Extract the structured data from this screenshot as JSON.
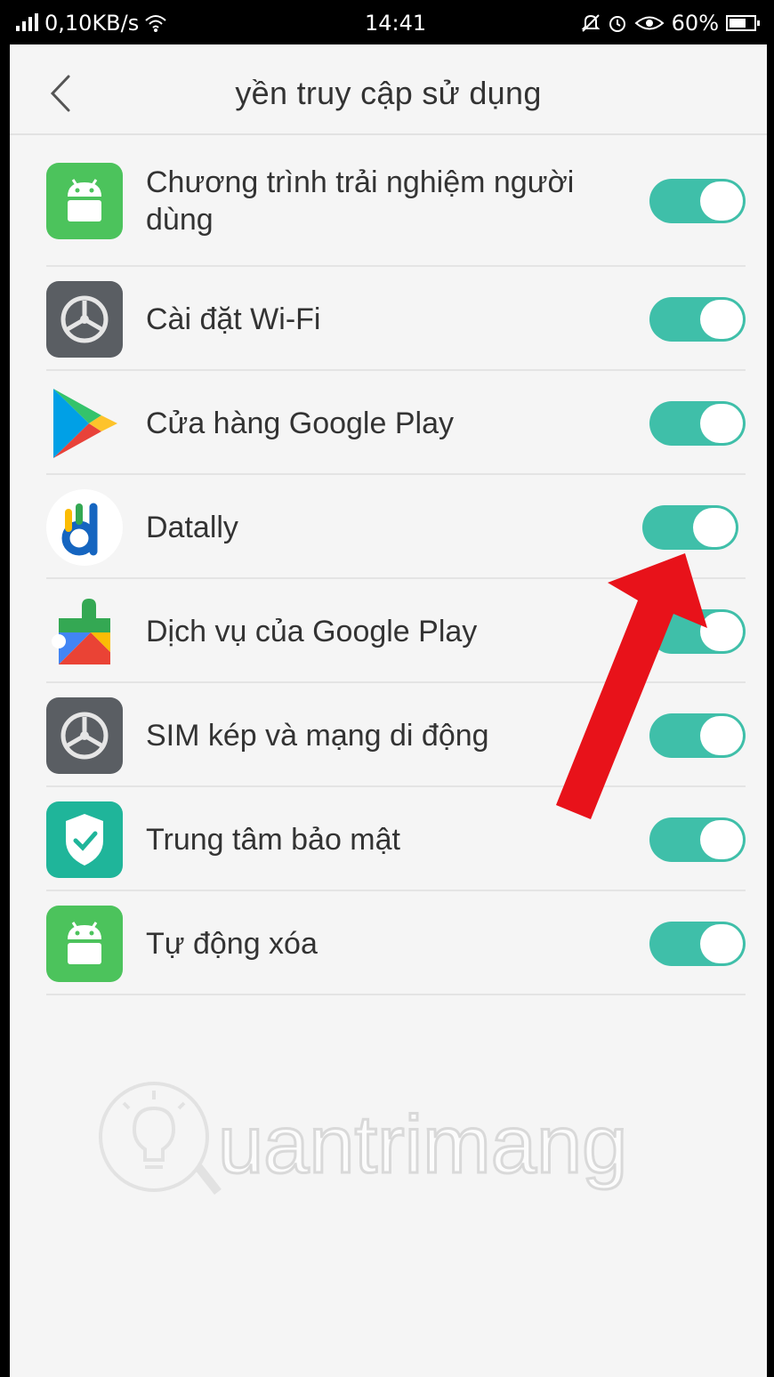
{
  "status_bar": {
    "network_speed": "0,10KB/s",
    "time": "14:41",
    "battery": "60%"
  },
  "header": {
    "title": "yền truy cập sử dụng"
  },
  "apps": [
    {
      "label": "Chương trình trải nghiệm người dùng",
      "icon": "android-icon",
      "enabled": true
    },
    {
      "label": "Cài đặt Wi-Fi",
      "icon": "settings-gear-icon",
      "enabled": true
    },
    {
      "label": "Cửa hàng Google Play",
      "icon": "google-play-store-icon",
      "enabled": true
    },
    {
      "label": "Datally",
      "icon": "datally-icon",
      "enabled": true
    },
    {
      "label": "Dịch vụ của Google Play",
      "icon": "google-play-services-icon",
      "enabled": true
    },
    {
      "label": "SIM kép và mạng di động",
      "icon": "settings-gear-icon",
      "enabled": true
    },
    {
      "label": "Trung tâm bảo mật",
      "icon": "security-shield-icon",
      "enabled": true
    },
    {
      "label": "Tự động xóa",
      "icon": "android-icon",
      "enabled": true
    }
  ],
  "colors": {
    "toggle_on": "#3fbfa9",
    "arrow": "#e8121a"
  },
  "watermark": "uantrimang"
}
